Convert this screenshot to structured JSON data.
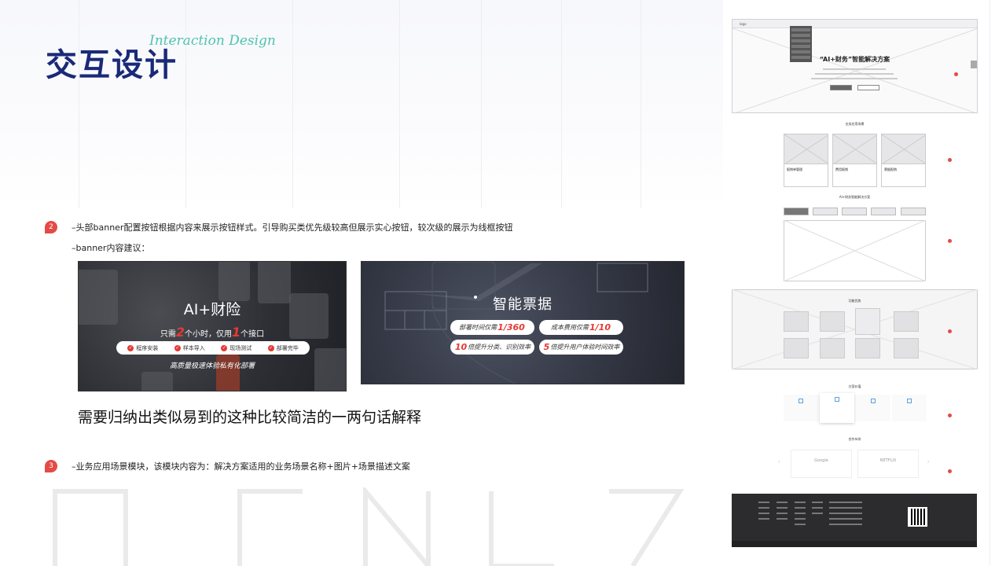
{
  "header": {
    "title": "交互设计",
    "subtitle_en": "Interaction Design"
  },
  "notes": [
    {
      "number": "2",
      "lines": [
        "–头部banner配置按钮根据内容来展示按钮样式。引导购买类优先级较高但展示实心按钮，较次级的展示为线框按钮",
        "–banner内容建议："
      ]
    },
    {
      "number": "3",
      "lines": [
        "–业务应用场景模块，该模块内容为：解决方案适用的业务场景名称+图片+场景描述文案"
      ]
    }
  ],
  "banner1": {
    "title": "AI+财险",
    "sub_prefix": "只需",
    "sub_n1": "2",
    "sub_mid": "个小时，仅用",
    "sub_n2": "1",
    "sub_suffix": "个接口",
    "steps": [
      "程序安装",
      "样本导入",
      "现场测试",
      "部署完毕"
    ],
    "footer": "高质量极速体验私有化部署"
  },
  "banner2": {
    "title": "智能票据",
    "pills": [
      {
        "text": "部署时间仅需",
        "value": "1/360"
      },
      {
        "text": "成本费用仅需",
        "value": "1/10"
      },
      {
        "value": "10",
        "text": "倍提升分类、识别效率"
      },
      {
        "value": "5",
        "text": "倍提升用户体验时间效率"
      }
    ]
  },
  "caption": "需要归纳出类似易到的这种比较简洁的一两句话解释",
  "wireframe": {
    "logo": "logo",
    "hero_title": "“AI+财务”智能解决方案",
    "section_scenes": "业务应用场景",
    "scene_cards": [
      "报销单管理",
      "费用报销",
      "票据报销"
    ],
    "section_solution": "AI+财务智能解决方案",
    "section_features": "功能优势",
    "section_value": "方案价值",
    "section_partners": "合作伙伴",
    "partners": [
      "Google",
      "NETFLIX"
    ]
  }
}
